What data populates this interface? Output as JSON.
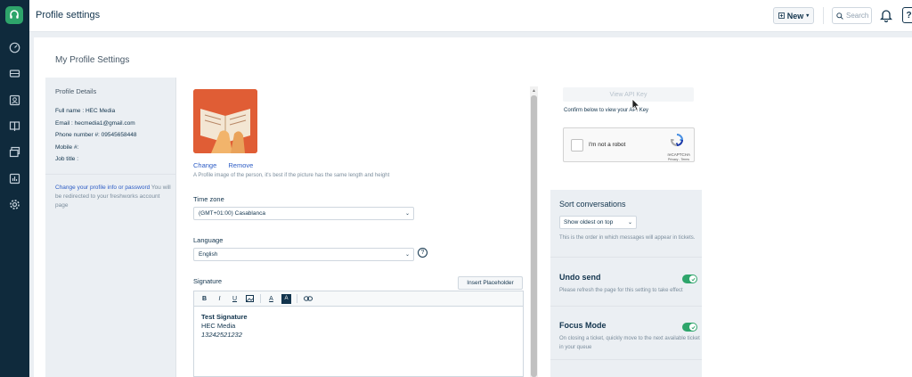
{
  "header": {
    "title": "Profile settings",
    "new_label": "New",
    "search_placeholder": "Search",
    "help_label": "?"
  },
  "nav": {
    "icons": [
      "dashboard-icon",
      "tickets-icon",
      "contacts-icon",
      "knowledge-base-icon",
      "inbox-icon",
      "reports-icon",
      "settings-icon"
    ]
  },
  "card": {
    "title": "My Profile Settings"
  },
  "profile": {
    "heading": "Profile Details",
    "full_name": "Full name : HEC Media",
    "email": "Email : hecmedia1@gmail.com",
    "phone": "Phone number #: 09545658448",
    "mobile": "Mobile #:",
    "job_title": "Job title :",
    "note_link": "Change your profile info or password",
    "note_text": " You will be redirected to your freshworks account page"
  },
  "form": {
    "change_label": "Change",
    "remove_label": "Remove",
    "photo_hint": "A Profile image of the person, it's best if the picture has the same length and height",
    "timezone_label": "Time zone",
    "timezone_value": "(GMT+01:00) Casablanca",
    "language_label": "Language",
    "language_value": "English",
    "help_label": "?",
    "signature_label": "Signature",
    "insert_placeholder_label": "Insert Placeholder",
    "toolbar": [
      "B",
      "I",
      "U",
      "image",
      "A",
      "A",
      "link"
    ],
    "signature_lines": [
      "Test Signature",
      "HEC Media",
      "13242521232"
    ]
  },
  "api": {
    "view_api_label": "View API Key",
    "confirm_note": "Confirm below to view your API Key",
    "captcha_label": "I'm not a robot",
    "captcha_brand": "reCAPTCHA",
    "captcha_links": "Privacy - Terms"
  },
  "sort": {
    "title": "Sort conversations",
    "value": "Show oldest on top",
    "desc": "This is the order in which messages will appear in tickets."
  },
  "undo": {
    "title": "Undo send",
    "desc": "Please refresh the page for this setting to take effect",
    "enabled": true
  },
  "focus": {
    "title": "Focus Mode",
    "desc": "On closing a ticket, quickly move to the next available ticket in your queue",
    "enabled": true
  },
  "colors": {
    "accent": "#2ea56b",
    "link": "#2c5cc5",
    "rail": "#0f2a3c"
  }
}
